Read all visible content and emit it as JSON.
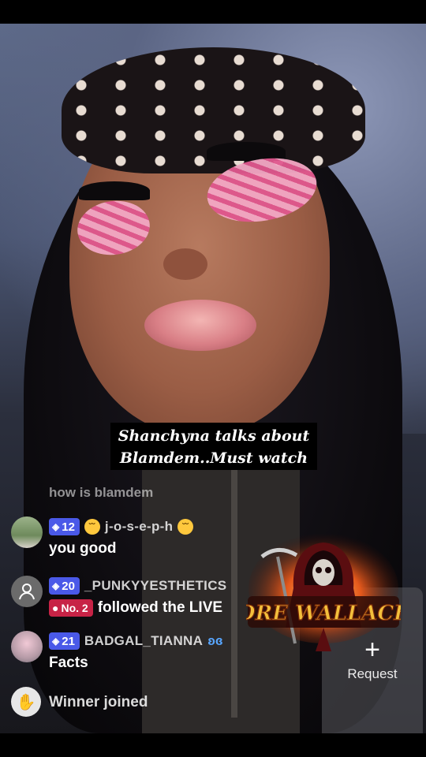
{
  "caption": {
    "line1": "Shanchyna talks about",
    "line2": "Blamdem..Must watch"
  },
  "faded_comment": "how is blamdem",
  "comments": [
    {
      "level": "12",
      "username": "j-o-s-e-p-h",
      "text": "you good"
    },
    {
      "level": "20",
      "username": "_PUNKYYESTHETICS",
      "rank": "No. 2",
      "text": "followed the LIVE"
    },
    {
      "level": "21",
      "username": "BADGAL_TIANNA",
      "text": "Facts"
    },
    {
      "text": "Winner joined"
    }
  ],
  "request_button": {
    "label": "Request",
    "icon": "plus-icon"
  },
  "logo": {
    "text": "DRE WALLACE"
  },
  "colors": {
    "level_badge": "#4a59e8",
    "rank_badge": "#c72346",
    "caption_bg": "#000000"
  }
}
